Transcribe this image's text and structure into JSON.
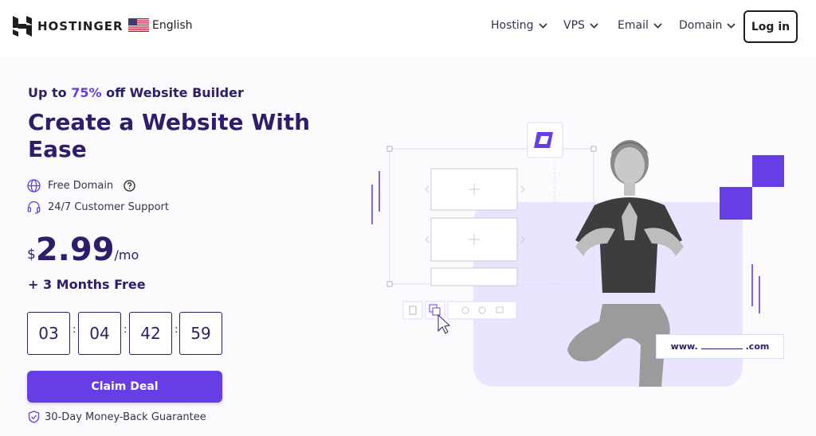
{
  "header": {
    "brand": "HOSTINGER",
    "language": "English",
    "nav": [
      {
        "label": "Hosting"
      },
      {
        "label": "VPS"
      },
      {
        "label": "Email"
      },
      {
        "label": "Domain"
      }
    ],
    "login_label": "Log in"
  },
  "hero": {
    "promo_prefix": "Up to ",
    "promo_discount": "75%",
    "promo_suffix": " off Website Builder",
    "headline": "Create a Website With Ease",
    "features": [
      {
        "label": "Free Domain",
        "icon": "globe-icon"
      },
      {
        "label": "24/7 Customer Support",
        "icon": "headset-icon"
      }
    ],
    "price": {
      "currency": "$",
      "amount": "2.99",
      "period": "/mo"
    },
    "bonus": "+ 3 Months Free",
    "timer": {
      "days": "03",
      "hours": "04",
      "minutes": "42",
      "seconds": "59",
      "separator": ":"
    },
    "cta_label": "Claim Deal",
    "guarantee": "30-Day Money-Back Guarantee",
    "domain_prefix": "www.",
    "domain_suffix": ".com"
  },
  "colors": {
    "accent": "#673de6",
    "text_dark": "#2f1c6a",
    "panel_bg": "#ebe4ff"
  }
}
